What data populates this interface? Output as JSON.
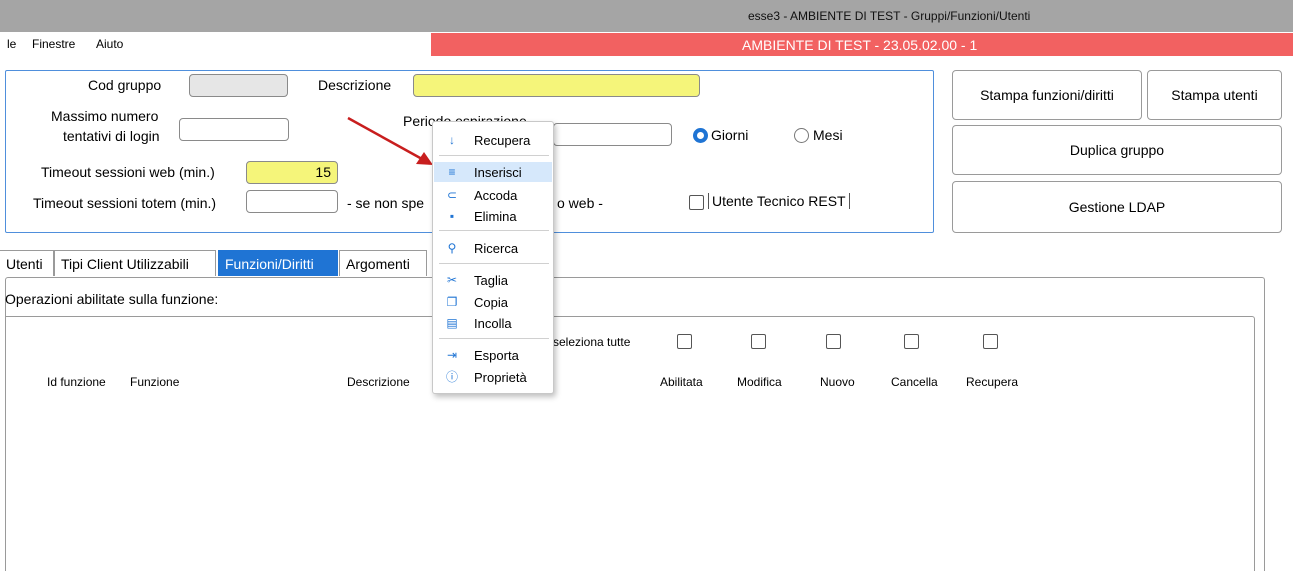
{
  "window": {
    "title": "esse3 - AMBIENTE DI TEST - Gruppi/Funzioni/Utenti"
  },
  "menubar": {
    "items": [
      "le",
      "Finestre",
      "Aiuto"
    ]
  },
  "env_banner": "AMBIENTE DI TEST - 23.05.02.00 - 1",
  "form": {
    "cod_gruppo_label": "Cod gruppo",
    "cod_gruppo_value": "",
    "descrizione_label": "Descrizione",
    "descrizione_value": "",
    "max_login_label_1": "Massimo numero",
    "max_login_label_2": "tentativi di login",
    "max_login_value": "",
    "periodo_label": "Periodo espirazione",
    "periodo_value": "",
    "radio_giorni": "Giorni",
    "radio_mesi": "Mesi",
    "radio_selected": "Giorni",
    "timeout_web_label": "Timeout sessioni web (min.)",
    "timeout_web_value": "15",
    "timeout_totem_label": "Timeout sessioni totem (min.)",
    "timeout_totem_value": "",
    "timeout_totem_note": "- se non spe",
    "timeout_totem_note_end": "o web -",
    "utente_tecnico_label": "Utente Tecnico REST",
    "utente_tecnico_checked": false
  },
  "buttons": {
    "stampa_funzioni": "Stampa funzioni/diritti",
    "stampa_utenti": "Stampa utenti",
    "duplica": "Duplica gruppo",
    "ldap": "Gestione LDAP"
  },
  "tabs": [
    {
      "label": "Utenti",
      "active": false
    },
    {
      "label": "Tipi Client Utilizzabili",
      "active": false
    },
    {
      "label": "Funzioni/Diritti",
      "active": true
    },
    {
      "label": "Argomenti",
      "active": false
    }
  ],
  "panel": {
    "operations_label": "Operazioni abilitate sulla funzione:",
    "select_all_label": "seleziona tutte",
    "columns": [
      "Id funzione",
      "Funzione",
      "Descrizione",
      "Abilitata",
      "Modifica",
      "Nuovo",
      "Cancella",
      "Recupera"
    ]
  },
  "context_menu": {
    "items": [
      {
        "label": "Recupera",
        "icon": "download-arrow-icon",
        "glyph": "↓"
      },
      {
        "label": "Inserisci",
        "icon": "insert-lines-icon",
        "glyph": "≡",
        "highlighted": true
      },
      {
        "label": "Accoda",
        "icon": "append-icon",
        "glyph": "⊂"
      },
      {
        "label": "Elimina",
        "icon": "delete-icon",
        "glyph": "▪"
      },
      {
        "label": "Ricerca",
        "icon": "search-icon",
        "glyph": "⚲"
      },
      {
        "label": "Taglia",
        "icon": "scissors-icon",
        "glyph": "✂"
      },
      {
        "label": "Copia",
        "icon": "copy-icon",
        "glyph": "❐"
      },
      {
        "label": "Incolla",
        "icon": "paste-icon",
        "glyph": "▤"
      },
      {
        "label": "Esporta",
        "icon": "export-icon",
        "glyph": "⇥"
      },
      {
        "label": "Proprietà",
        "icon": "info-icon",
        "glyph": "ⓘ"
      }
    ]
  },
  "colors": {
    "accent": "#1f74d4",
    "banner": "#f26161",
    "required_field": "#f5f57a",
    "arrow": "#c81e1e"
  }
}
